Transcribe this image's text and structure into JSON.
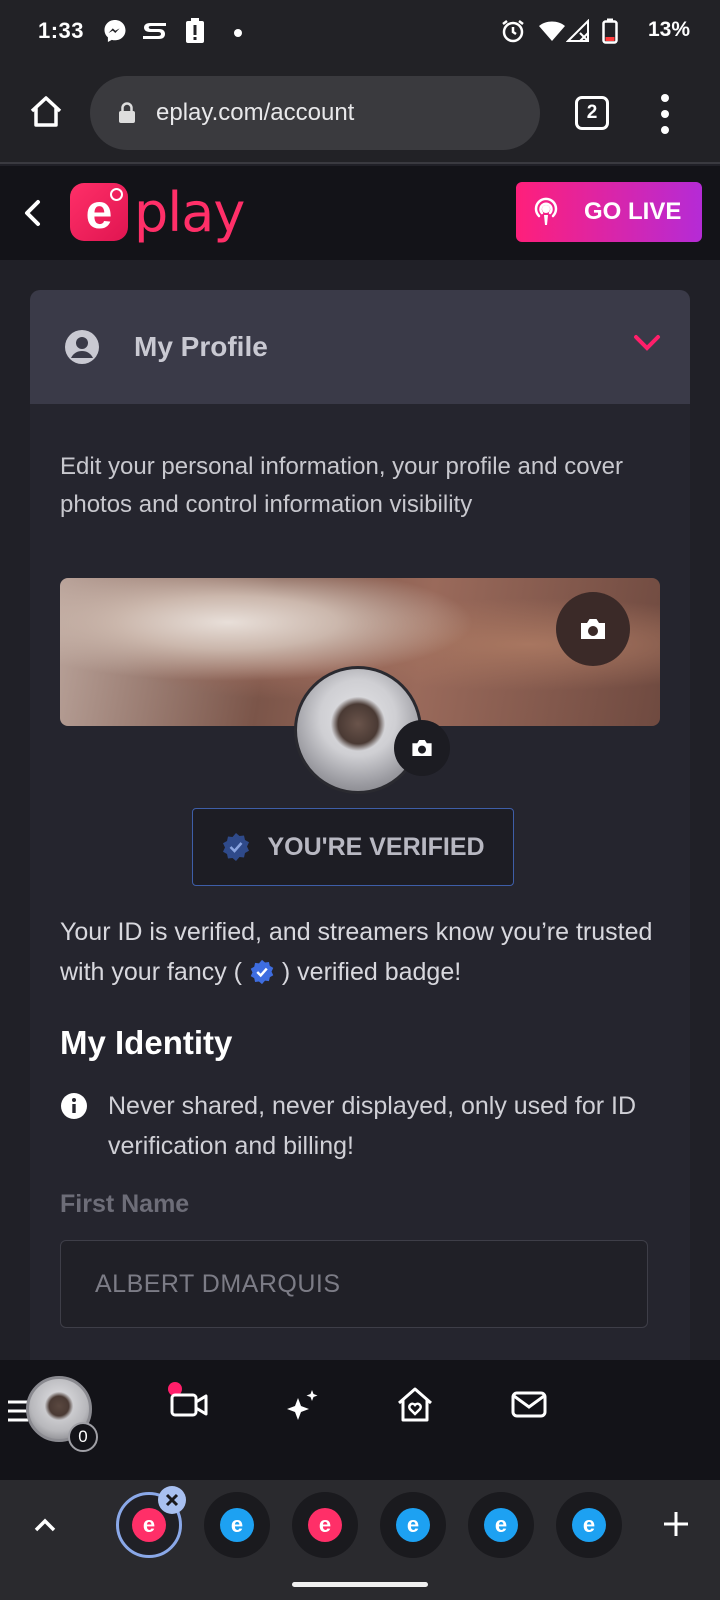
{
  "status_bar": {
    "time": "1:33",
    "battery_text": "13%",
    "icons": [
      "messenger-icon",
      "s-app-icon",
      "battery-alert-icon",
      "alarm-icon",
      "wifi-icon",
      "signal-icon",
      "battery-icon"
    ]
  },
  "browser": {
    "url": "eplay.com/account",
    "tab_count": "2"
  },
  "app_header": {
    "logo_letter": "e",
    "logo_text": "play",
    "go_live_label": "GO LIVE"
  },
  "profile_card": {
    "title": "My Profile",
    "description": "Edit your personal information, your profile and cover photos and control information visibility",
    "verified_label": "YOU'RE VERIFIED",
    "verify_note_before": "Your ID is verified, and streamers know you’re trusted with your fancy ( ",
    "verify_note_after": " ) verified badge!",
    "identity_title": "My Identity",
    "identity_info": "Never shared, never displayed, only used for ID verification and billing!",
    "first_name_label": "First Name",
    "first_name_value": "ALBERT DMARQUIS"
  },
  "bottom_nav": {
    "notification_count": "0"
  },
  "tab_strip": {
    "tabs": [
      {
        "favicon": "e",
        "color": "pink",
        "active": true
      },
      {
        "favicon": "e",
        "color": "blue",
        "active": false
      },
      {
        "favicon": "e",
        "color": "pink",
        "active": false
      },
      {
        "favicon": "e",
        "color": "blue",
        "active": false
      },
      {
        "favicon": "e",
        "color": "blue",
        "active": false
      },
      {
        "favicon": "e",
        "color": "blue",
        "active": false
      }
    ]
  },
  "colors": {
    "brand_pink": "#ff2f68",
    "go_live_gradient_start": "#ff1f7a",
    "go_live_gradient_end": "#b52bd6",
    "verified_blue": "#3e6de0"
  }
}
